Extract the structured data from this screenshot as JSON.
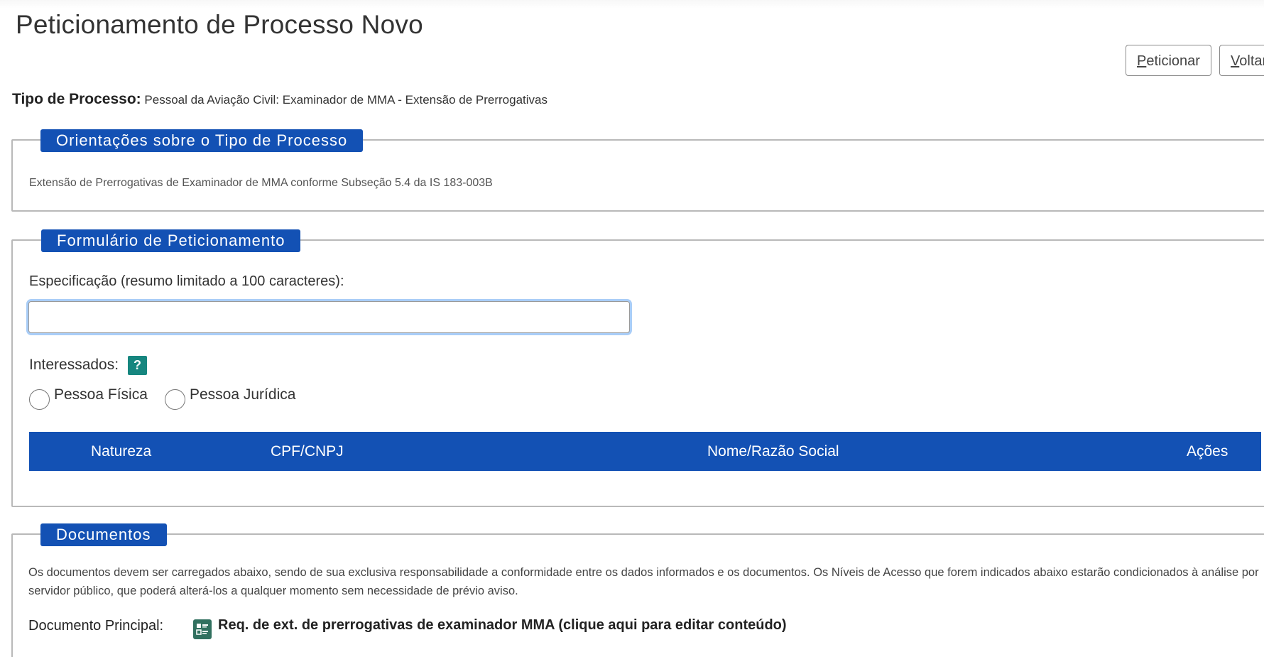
{
  "page": {
    "title": "Peticionamento de Processo Novo"
  },
  "actions": {
    "peticionar_first": "P",
    "peticionar_rest": "eticionar",
    "voltar_first": "V",
    "voltar_rest": "oltar"
  },
  "tipo_processo": {
    "label": "Tipo de Processo:",
    "value": "Pessoal da Aviação Civil: Examinador de MMA - Extensão de Prerrogativas"
  },
  "orientacoes": {
    "legend": "Orientações sobre o Tipo de Processo",
    "text": "Extensão de Prerrogativas de Examinador de MMA conforme Subseção 5.4 da IS 183-003B"
  },
  "formulario": {
    "legend": "Formulário de Peticionamento",
    "especificacao_label": "Especificação (resumo limitado a 100 caracteres):",
    "especificacao_value": "",
    "interessados_label": "Interessados:",
    "help_icon": "?",
    "radios": {
      "pessoa_fisica": "Pessoa Física",
      "pessoa_juridica": "Pessoa Jurídica"
    },
    "table_headers": {
      "natureza": "Natureza",
      "cpf_cnpj": "CPF/CNPJ",
      "nome": "Nome/Razão Social",
      "acoes": "Ações"
    }
  },
  "documentos": {
    "legend": "Documentos",
    "text": "Os documentos devem ser carregados abaixo, sendo de sua exclusiva responsabilidade a conformidade entre os dados informados e os documentos. Os Níveis de Acesso que forem indicados abaixo estarão condicionados à análise por servidor público, que poderá alterá-los a qualquer momento sem necessidade de prévio aviso.",
    "principal_label": "Documento Principal:",
    "principal_link": "Req. de ext. de prerrogativas de examinador MMA (clique aqui para editar conteúdo)"
  },
  "colors": {
    "primary_blue": "#1351b4",
    "help_teal": "#16867f",
    "doc_icon_green": "#31705f"
  }
}
